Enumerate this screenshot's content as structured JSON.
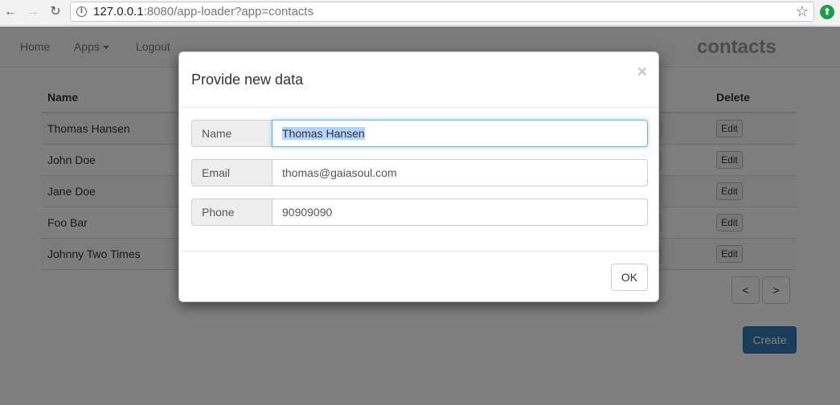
{
  "browser": {
    "url_host": "127.0.0.1",
    "url_rest": ":8080/app-loader?app=contacts",
    "back_glyph": "←",
    "forward_glyph": "→",
    "reload_glyph": "↻",
    "info_glyph": "i",
    "star_glyph": "☆",
    "ext_glyph": "⬆"
  },
  "navbar": {
    "home": "Home",
    "apps": "Apps",
    "logout": "Logout",
    "brand": "contacts"
  },
  "table": {
    "headers": {
      "name": "Name",
      "delete": "Delete"
    },
    "rows": [
      {
        "name": "Thomas Hansen",
        "edit": "Edit"
      },
      {
        "name": "John Doe",
        "edit": "Edit"
      },
      {
        "name": "Jane Doe",
        "edit": "Edit"
      },
      {
        "name": "Foo Bar",
        "edit": "Edit"
      },
      {
        "name": "Johnny Two Times",
        "edit": "Edit"
      }
    ]
  },
  "pager": {
    "prev": "<",
    "next": ">"
  },
  "create_label": "Create",
  "modal": {
    "title": "Provide new data",
    "close_glyph": "×",
    "fields": {
      "name": {
        "label": "Name",
        "value": "Thomas Hansen"
      },
      "email": {
        "label": "Email",
        "value": "thomas@gaiasoul.com"
      },
      "phone": {
        "label": "Phone",
        "value": "90909090"
      }
    },
    "ok_label": "OK"
  },
  "colors": {
    "primary": "#337ab7",
    "focus": "#66afe9",
    "selection": "#b3d4fc",
    "extension": "#1a9e4b"
  }
}
